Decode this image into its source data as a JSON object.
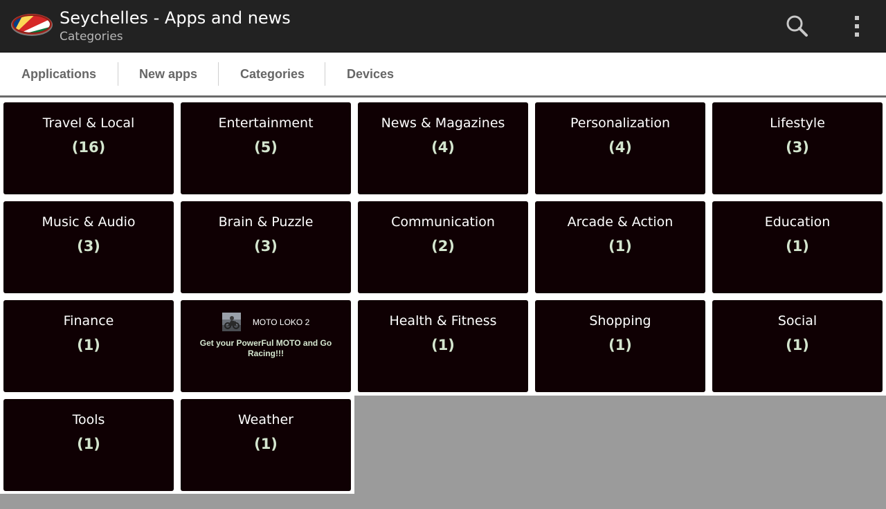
{
  "actionbar": {
    "title": "Seychelles - Apps and news",
    "subtitle": "Categories",
    "logo_icon": "seychelles-flag-logo-icon",
    "search_icon": "search-icon",
    "overflow_icon": "overflow-menu-icon"
  },
  "tabs": [
    {
      "label": "Applications"
    },
    {
      "label": "New apps"
    },
    {
      "label": "Categories"
    },
    {
      "label": "Devices"
    }
  ],
  "categories": [
    {
      "name": "Travel & Local",
      "count": "(16)"
    },
    {
      "name": "Entertainment",
      "count": "(5)"
    },
    {
      "name": "News & Magazines",
      "count": "(4)"
    },
    {
      "name": "Personalization",
      "count": "(4)"
    },
    {
      "name": "Lifestyle",
      "count": "(3)"
    },
    {
      "name": "Music & Audio",
      "count": "(3)"
    },
    {
      "name": "Brain & Puzzle",
      "count": "(3)"
    },
    {
      "name": "Communication",
      "count": "(2)"
    },
    {
      "name": "Arcade & Action",
      "count": "(1)"
    },
    {
      "name": "Education",
      "count": "(1)"
    },
    {
      "name": "Finance",
      "count": "(1)"
    },
    {
      "name": "Health & Fitness",
      "count": "(1)"
    },
    {
      "name": "Shopping",
      "count": "(1)"
    },
    {
      "name": "Social",
      "count": "(1)"
    },
    {
      "name": "Tools",
      "count": "(1)"
    },
    {
      "name": "Weather",
      "count": "(1)"
    }
  ],
  "ad": {
    "title": "MOTO LOKO 2",
    "text": "Get your PowerFul MOTO and Go Racing!!!",
    "thumb_icon": "motorcycle-thumbnail-icon"
  },
  "colors": {
    "actionbar_bg": "#222222",
    "tile_bg": "#0f0003",
    "count_text": "#d4e6cf",
    "tab_text": "#666666"
  }
}
